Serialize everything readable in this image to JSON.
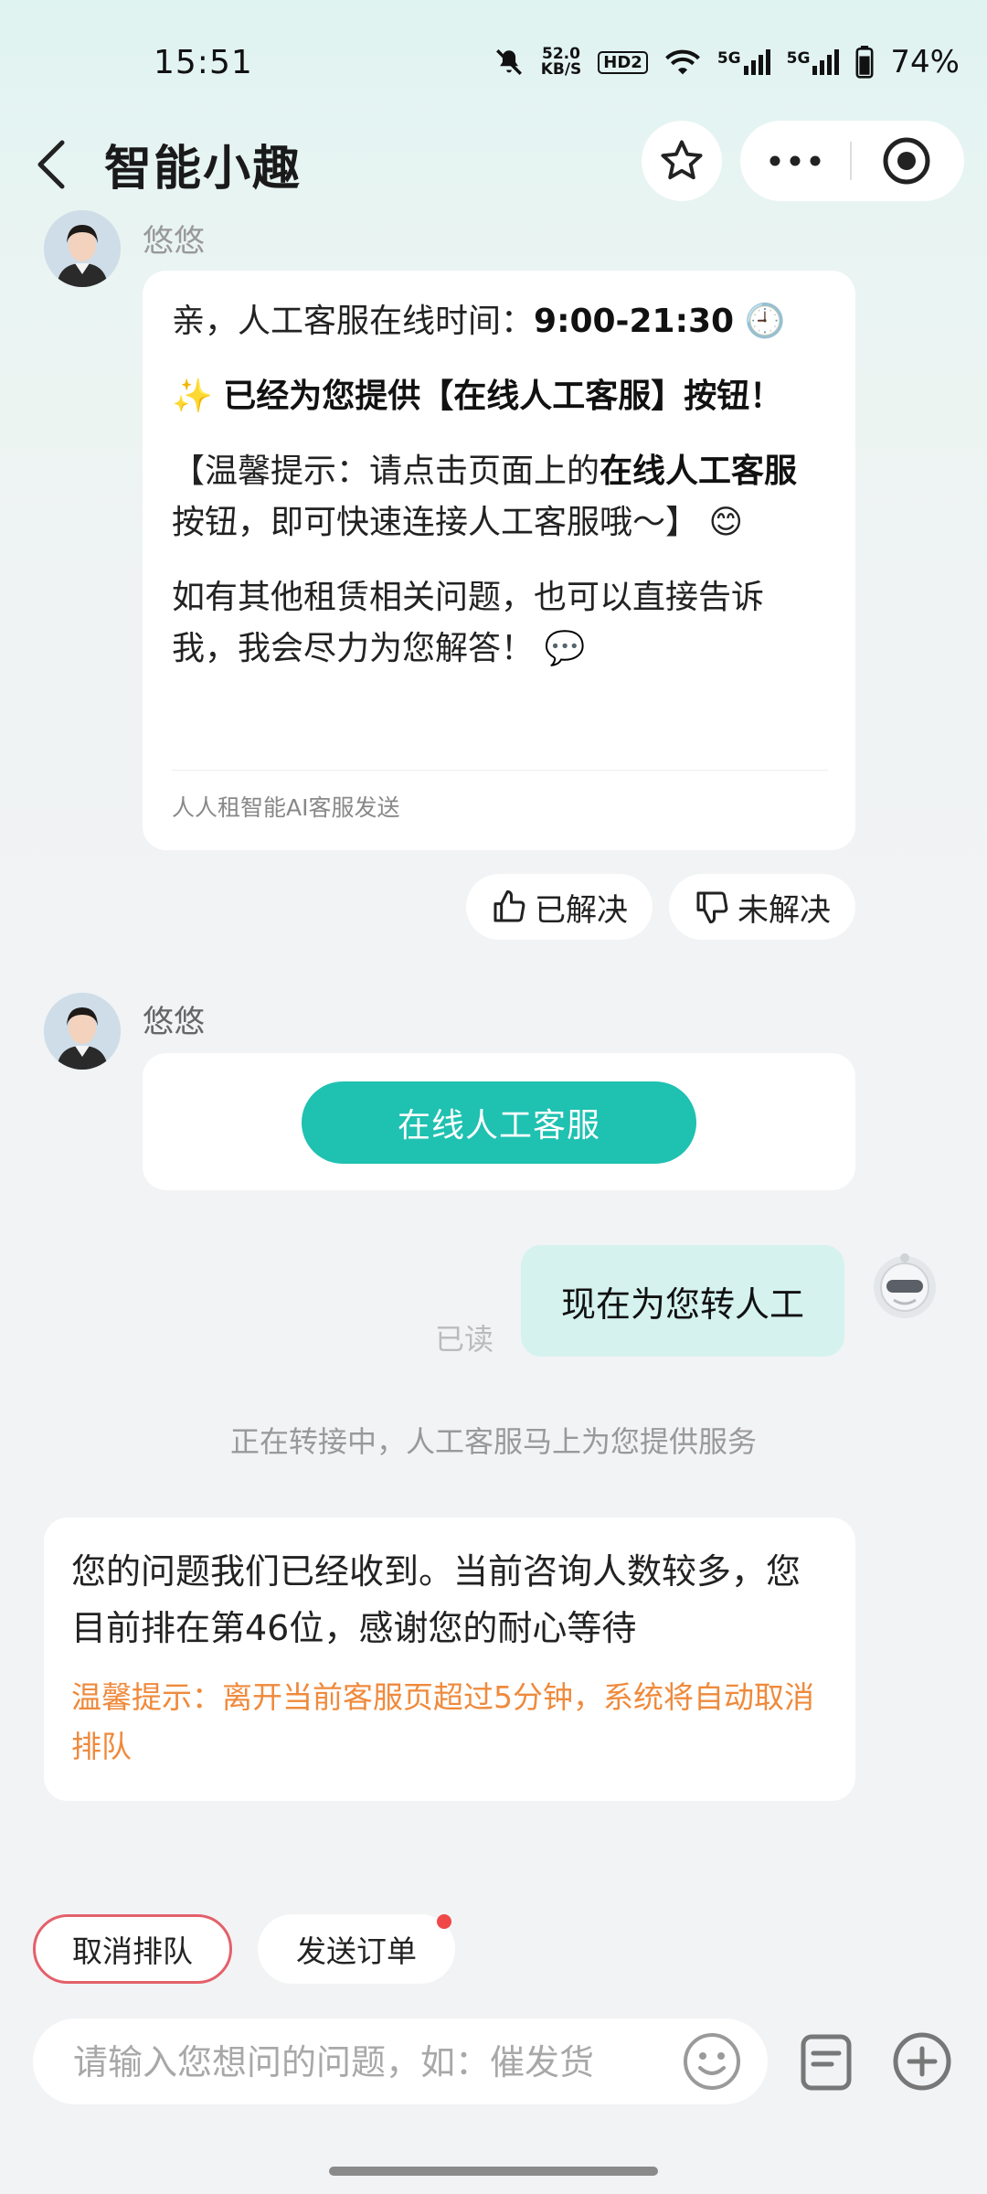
{
  "status_bar": {
    "time": "15:51",
    "net_speed_value": "52.0",
    "net_speed_unit": "KB/S",
    "hd_badge": "HD2",
    "signal_1": "5G",
    "signal_2": "5G",
    "battery": "74%"
  },
  "header": {
    "title": "智能小趣",
    "icons": [
      "back-icon",
      "star-icon",
      "more-icon",
      "close-target-icon"
    ]
  },
  "messages": {
    "agent_name_top": "悠悠",
    "msg1": {
      "p1_prefix": "亲，人工客服在线时间：",
      "p1_hours": "9:00-21:30",
      "p1_emoji": "🕘",
      "p2_emoji": "✨",
      "p2_bold": "已经为您提供【在线人工客服】按钮！",
      "p3_prefix": "【温馨提示：请点击页面上的",
      "p3_bold": "在线人工客服",
      "p3_suffix": "按钮，即可快速连接人工客服哦～】",
      "p3_emoji": "😊",
      "p4": "如有其他租赁相关问题，也可以直接告诉我，我会尽力为您解答！",
      "p4_emoji": "💬",
      "footnote": "人人租智能AI客服发送"
    },
    "feedback": {
      "solved": "已解决",
      "unsolved": "未解决"
    },
    "agent_name_2": "悠悠",
    "cta_label": "在线人工客服",
    "user_message": "现在为您转人工",
    "read_status": "已读",
    "system_tip": "正在转接中，人工客服马上为您提供服务",
    "queue": {
      "text": "您的问题我们已经收到。当前咨询人数较多，您目前排在第46位，感谢您的耐心等待",
      "warning": "温馨提示：离开当前客服页超过5分钟，系统将自动取消排队"
    }
  },
  "quick_actions": {
    "cancel_queue": "取消排队",
    "send_order": "发送订单"
  },
  "input": {
    "placeholder": "请输入您想问的问题，如：催发货"
  },
  "colors": {
    "accent": "#1fc1b1",
    "user_bubble": "#d5f2ef",
    "warning": "#ef8a3c",
    "cancel_border": "#e3606a"
  }
}
